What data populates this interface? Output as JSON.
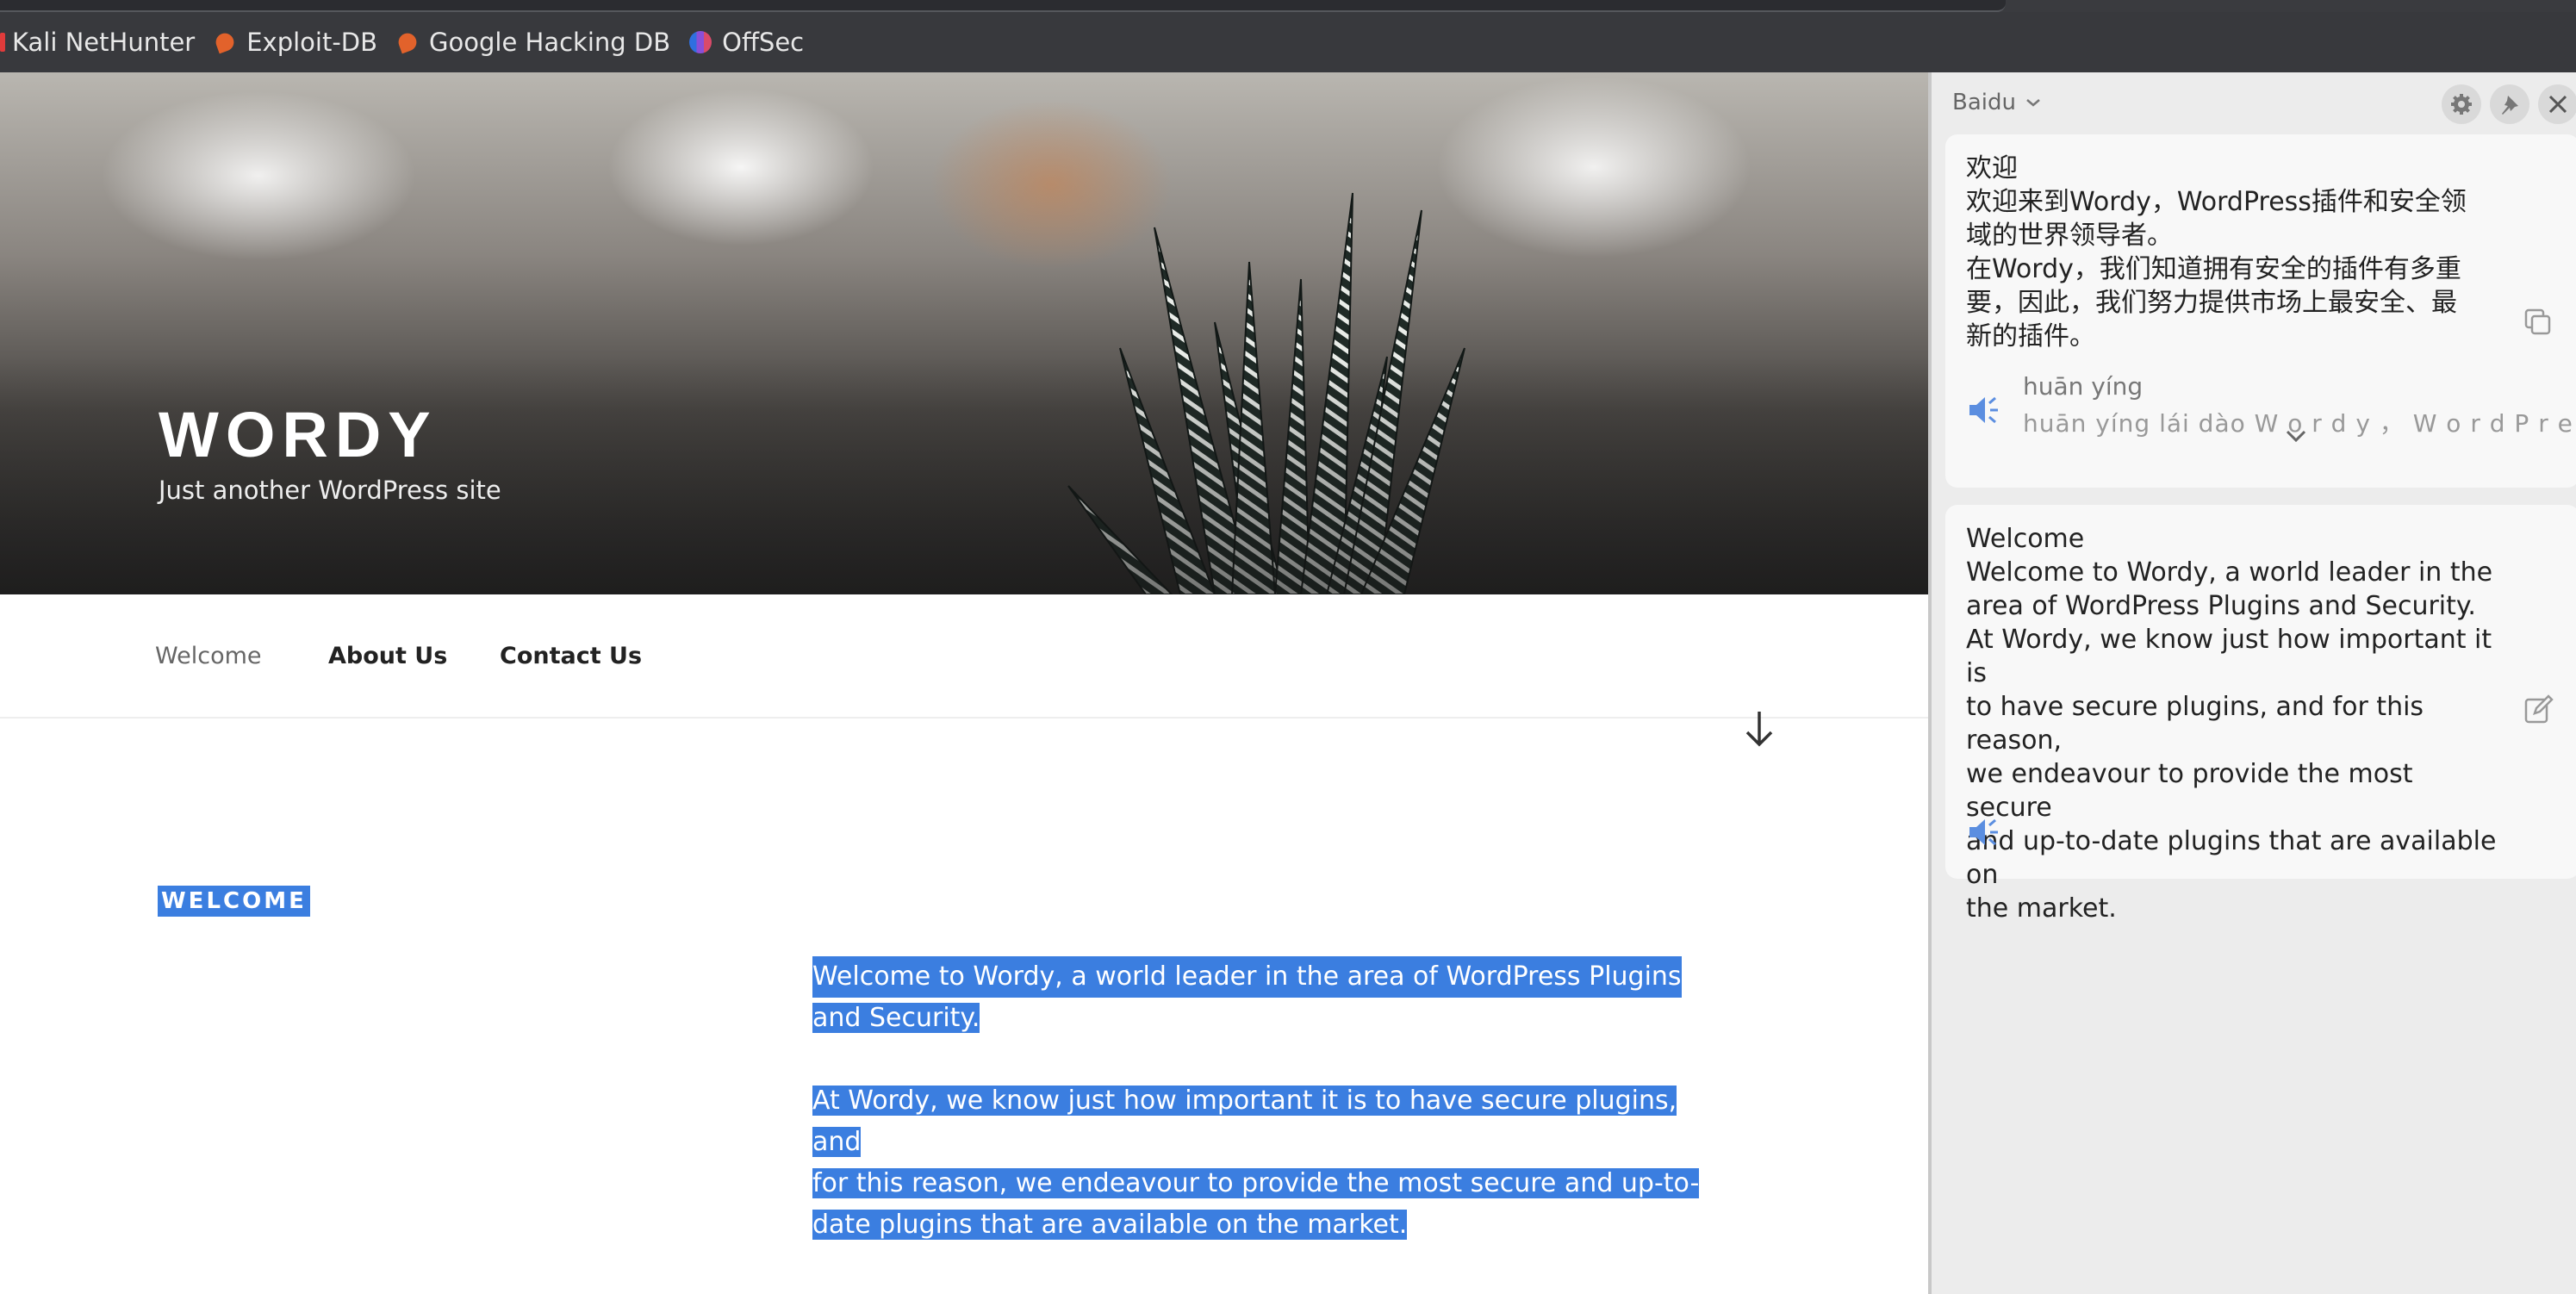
{
  "browser": {
    "bookmarks": [
      {
        "label": "Kali NetHunter",
        "icon": "kali-icon"
      },
      {
        "label": "Exploit-DB",
        "icon": "exploit-db-icon"
      },
      {
        "label": "Google Hacking DB",
        "icon": "exploit-db-icon"
      },
      {
        "label": "OffSec",
        "icon": "offsec-icon"
      }
    ]
  },
  "site": {
    "title": "WORDY",
    "tagline": "Just another WordPress site",
    "nav": [
      "Welcome",
      "About Us",
      "Contact Us"
    ],
    "heading": "WELCOME",
    "paragraph1_line1": "Welcome to Wordy, a world leader in the area of WordPress Plugins",
    "paragraph1_line2": "and Security.",
    "paragraph2_line1": "At Wordy, we know just how important it is to have secure plugins, and",
    "paragraph2_line2": "for this reason, we endeavour to provide the most secure and up-to-",
    "paragraph2_line3": "date plugins that are available on the market."
  },
  "translator": {
    "engine": "Baidu",
    "translation_lines": [
      "欢迎",
      "欢迎来到Wordy，WordPress插件和安全领",
      "域的世界领导者。",
      "在Wordy，我们知道拥有安全的插件有多重",
      "要，因此，我们努力提供市场上最安全、最",
      "新的插件。"
    ],
    "pinyin_line1": "huān yíng",
    "pinyin_line2": "huān yíng lái dào W o r d y ， W o r d P r e",
    "source_lines": [
      "Welcome",
      "Welcome to Wordy, a world leader in the",
      "area of WordPress Plugins and Security.",
      "At Wordy, we know just how important it is",
      "to have secure plugins, and for this reason,",
      "we endeavour to provide the most secure",
      "and up-to-date plugins that are available on",
      "the market."
    ],
    "accent_color": "#3b7ee0"
  }
}
